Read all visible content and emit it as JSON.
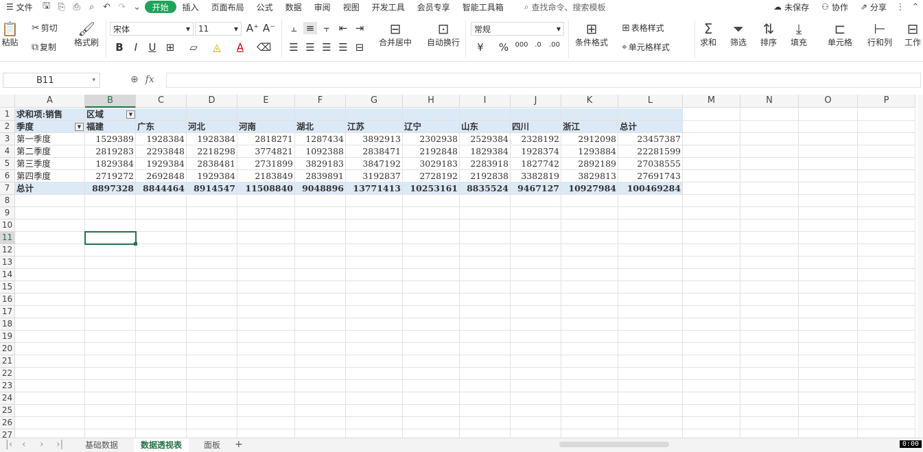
{
  "menubar": {
    "file": "文件",
    "tabs": [
      "开始",
      "插入",
      "页面布局",
      "公式",
      "数据",
      "审阅",
      "视图",
      "开发工具",
      "会员专享",
      "智能工具箱"
    ],
    "search": "查找命令、搜索模板",
    "unsaved": "未保存",
    "collab": "协作",
    "share": "分享"
  },
  "ribbon": {
    "paste": "粘贴",
    "cut": "剪切",
    "copy": "复制",
    "format_painter": "格式刷",
    "font_name": "宋体",
    "font_size": "11",
    "merge_center": "合并居中",
    "wrap_text": "自动换行",
    "number_format": "常规",
    "cond_format": "条件格式",
    "table_style": "表格样式",
    "cell_style": "单元格样式",
    "sum": "求和",
    "filter": "筛选",
    "sort": "排序",
    "fill": "填充",
    "cells": "单元格",
    "rows_cols": "行和列",
    "worksheet": "工作"
  },
  "formula": {
    "name_box": "B11",
    "fx": "fx",
    "content": ""
  },
  "columns": [
    "A",
    "B",
    "C",
    "D",
    "E",
    "F",
    "G",
    "H",
    "I",
    "J",
    "K",
    "L",
    "M",
    "N",
    "O",
    "P"
  ],
  "rows": [
    "1",
    "2",
    "3",
    "4",
    "5",
    "6",
    "7",
    "8",
    "9",
    "10",
    "11",
    "12",
    "13",
    "14",
    "15",
    "16",
    "17",
    "18",
    "19",
    "20",
    "21",
    "22",
    "23",
    "24",
    "25",
    "26",
    "27"
  ],
  "pivot": {
    "r1_label": "求和项:销售",
    "r1_field": "区域",
    "row_field": "季度",
    "headers": [
      "福建",
      "广东",
      "河北",
      "河南",
      "湖北",
      "江苏",
      "辽宁",
      "山东",
      "四川",
      "浙江",
      "总计"
    ],
    "data": [
      {
        "label": "第一季度",
        "values": [
          "1529389",
          "1928384",
          "1928384",
          "2818271",
          "1287434",
          "3892913",
          "2302938",
          "2529384",
          "2328192",
          "2912098",
          "23457387"
        ]
      },
      {
        "label": "第二季度",
        "values": [
          "2819283",
          "2293848",
          "2218298",
          "3774821",
          "1092388",
          "2838471",
          "2192848",
          "1829384",
          "1928374",
          "1293884",
          "22281599"
        ]
      },
      {
        "label": "第三季度",
        "values": [
          "1829384",
          "1929384",
          "2838481",
          "2731899",
          "3829183",
          "3847192",
          "3029183",
          "2283918",
          "1827742",
          "2892189",
          "27038555"
        ]
      },
      {
        "label": "第四季度",
        "values": [
          "2719272",
          "2692848",
          "1929384",
          "2183849",
          "2839891",
          "3192837",
          "2728192",
          "2192838",
          "3382819",
          "3829813",
          "27691743"
        ]
      }
    ],
    "total_label": "总计",
    "totals": [
      "8897328",
      "8844464",
      "8914547",
      "11508840",
      "9048896",
      "13771413",
      "10253161",
      "8835524",
      "9467127",
      "10927984",
      "100469284"
    ]
  },
  "sheets": [
    "基础数据",
    "数据透视表",
    "面板"
  ],
  "active_sheet": "数据透视表",
  "timer": "0:00",
  "colors": {
    "accent": "#217346",
    "start_tab": "#20a35a",
    "pivot_band": "#dce9f7"
  }
}
